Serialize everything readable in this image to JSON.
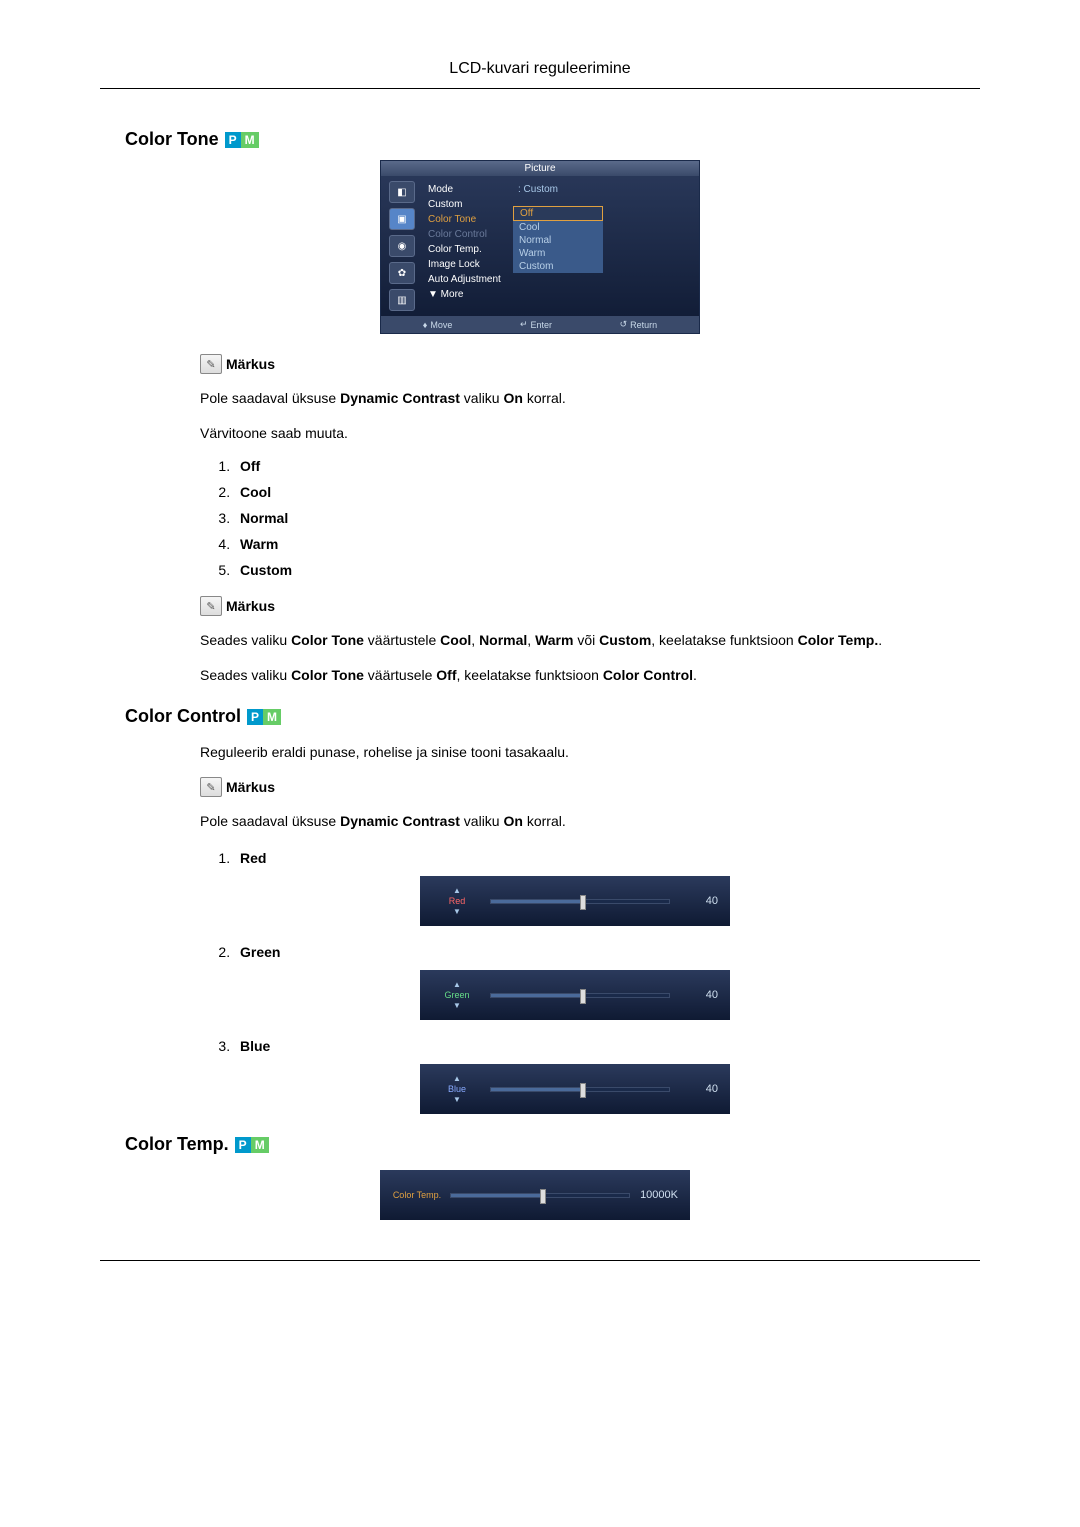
{
  "header": {
    "title": "LCD-kuvari reguleerimine"
  },
  "section1": {
    "title": "Color Tone",
    "osd": {
      "title": "Picture",
      "rows": [
        {
          "label": "Mode",
          "val": ": Custom"
        },
        {
          "label": "Custom",
          "val": ""
        },
        {
          "label": "Color Tone",
          "val": ":",
          "amber": true
        },
        {
          "label": "Color Control",
          "val": ":",
          "dim": true
        },
        {
          "label": "Color Temp.",
          "val": ":"
        },
        {
          "label": "Image Lock",
          "val": ":"
        },
        {
          "label": "Auto Adjustment",
          "val": ""
        },
        {
          "label": "▼ More",
          "val": ""
        }
      ],
      "popup": [
        "Off",
        "Cool",
        "Normal",
        "Warm",
        "Custom"
      ],
      "footer": {
        "move": "Move",
        "enter": "Enter",
        "return": "Return"
      }
    },
    "note_label": "Märkus",
    "p1_a": "Pole saadaval üksuse ",
    "p1_b": "Dynamic Contrast",
    "p1_c": " valiku ",
    "p1_d": "On",
    "p1_e": " korral.",
    "p2": "Värvitoone saab muuta.",
    "options": [
      "Off",
      "Cool",
      "Normal",
      "Warm",
      "Custom"
    ],
    "note2": "Märkus",
    "p3_a": "Seades valiku ",
    "p3_b": "Color Tone",
    "p3_c": " väärtustele ",
    "p3_d": "Cool",
    "p3_e": ", ",
    "p3_f": "Normal",
    "p3_g": ", ",
    "p3_h": "Warm",
    "p3_i": " või ",
    "p3_j": "Custom",
    "p3_k": ", keelatakse funktsioon ",
    "p3_l": "Color Temp.",
    "p3_m": ".",
    "p4_a": "Seades valiku ",
    "p4_b": "Color Tone",
    "p4_c": " väärtusele ",
    "p4_d": "Off",
    "p4_e": ", keelatakse funktsioon ",
    "p4_f": "Color Control",
    "p4_g": "."
  },
  "section2": {
    "title": "Color Control",
    "p1": "Reguleerib eraldi punase, rohelise ja sinise tooni tasakaalu.",
    "note_label": "Märkus",
    "p2_a": "Pole saadaval üksuse ",
    "p2_b": "Dynamic Contrast",
    "p2_c": " valiku ",
    "p2_d": "On",
    "p2_e": " korral.",
    "items": [
      {
        "label": "Red",
        "slider_label": "Red",
        "value": "40",
        "pct": 50
      },
      {
        "label": "Green",
        "slider_label": "Green",
        "value": "40",
        "pct": 50
      },
      {
        "label": "Blue",
        "slider_label": "Blue",
        "value": "40",
        "pct": 50
      }
    ]
  },
  "section3": {
    "title": "Color Temp.",
    "slider_label": "Color Temp.",
    "value": "10000K",
    "pct": 50
  }
}
